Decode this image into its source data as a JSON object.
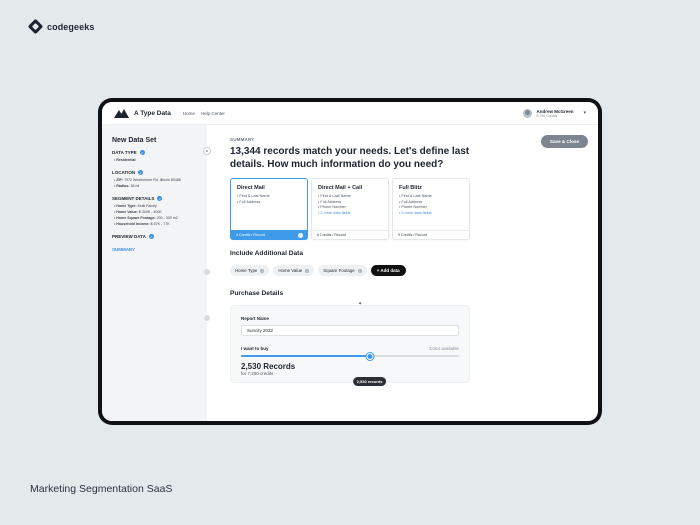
{
  "brand": {
    "name": "codegeeks"
  },
  "caption": "Marketing Segmentation SaaS",
  "app": {
    "title": "A Type Data",
    "nav": [
      "Home",
      "Help Center"
    ],
    "user": {
      "name": "Andrew McGreen",
      "credits": "8,750 Credits"
    }
  },
  "sidebar": {
    "title": "New Data Set",
    "sections": {
      "data_type": {
        "label": "DATA TYPE",
        "items": [
          "Residential"
        ]
      },
      "location": {
        "label": "LOCATION",
        "items": [
          {
            "key": "ZIP:",
            "value": "7972 Westheimer Rd, Illinois 85486"
          },
          {
            "key": "Radius:",
            "value": "36 mi"
          }
        ]
      },
      "segment": {
        "label": "SEGMENT DETAILS",
        "items": [
          {
            "key": "Home Type:",
            "value": "Multi Family"
          },
          {
            "key": "Home Value:",
            "value": "$ 300K - 400K"
          },
          {
            "key": "Home Square Footage:",
            "value": "200 - 300 m2"
          },
          {
            "key": "Household Income:",
            "value": "$ 67K - 77K"
          }
        ]
      },
      "preview": {
        "label": "PREVIEW DATA"
      },
      "summary": {
        "label": "SUMMARY"
      }
    }
  },
  "main": {
    "section_label": "SUMMARY",
    "headline": "13,344 records match your needs. Let's define last details. How much information do you need?",
    "save_button": "Save & Close",
    "plans": [
      {
        "name": "Direct Mail",
        "features": [
          "First & Last Name",
          "Full Address"
        ],
        "more": "",
        "footer": "4 Credits / Record",
        "selected": true
      },
      {
        "name": "Direct Mail + Call",
        "features": [
          "First & Last Name",
          "Full Address",
          "Phone Number"
        ],
        "more": "2 more data fields",
        "footer": "6 Credits / Record",
        "selected": false
      },
      {
        "name": "Full Blitz",
        "features": [
          "First & Last Name",
          "Full Address",
          "Phone Number"
        ],
        "more": "5 more data fields",
        "footer": "9 Credits / Record",
        "selected": false
      }
    ],
    "additional": {
      "title": "Include Additional Data",
      "chips": [
        "Home Type",
        "Home Value",
        "Square Footage"
      ],
      "add_button": "+ Add data"
    },
    "purchase": {
      "title": "Purchase Details",
      "report_label": "Report Name",
      "report_value": "Suncity 2022",
      "buy_label": "I want to buy",
      "available": "3,064 available",
      "slider_fraction": 0.59,
      "slider_tooltip": "2,530 records",
      "records": "2,530 Records",
      "credits": "for 7,200 credits"
    }
  },
  "colors": {
    "accent": "#3d9be9",
    "dark": "#1d2430",
    "save_button": "#7d8590"
  }
}
